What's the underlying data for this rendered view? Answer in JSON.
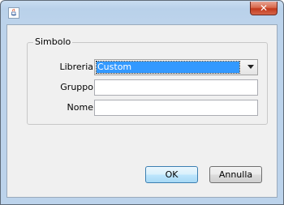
{
  "window": {
    "title": "",
    "close_symbol": "✕",
    "app_icon": "java-icon"
  },
  "dialog": {
    "group_title": "Simbolo",
    "fields": {
      "libreria": {
        "label": "Libreria",
        "value": "Custom"
      },
      "gruppo": {
        "label": "Gruppo",
        "value": ""
      },
      "nome": {
        "label": "Nome",
        "value": ""
      }
    },
    "buttons": {
      "ok": "OK",
      "cancel": "Annulla"
    }
  }
}
